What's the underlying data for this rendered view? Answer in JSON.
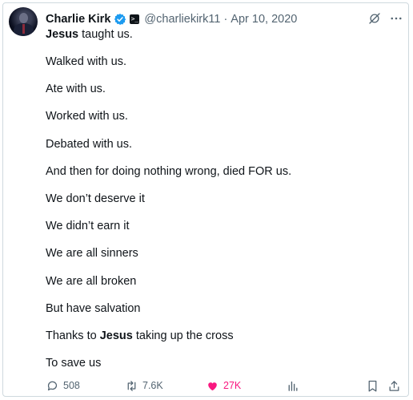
{
  "author": {
    "name": "Charlie Kirk",
    "handle": "@charliekirk11",
    "separator": "·",
    "date": "Apr 10, 2020",
    "affiliate_badge": ">_"
  },
  "tweet": {
    "lines": [
      {
        "bold": "Jesus",
        "text": " taught us."
      },
      {
        "bold": "",
        "text": "Walked with us."
      },
      {
        "bold": "",
        "text": "Ate with us."
      },
      {
        "bold": "",
        "text": "Worked with us."
      },
      {
        "bold": "",
        "text": "Debated with us."
      },
      {
        "bold": "",
        "text": "And then for doing nothing wrong, died FOR us."
      },
      {
        "bold": "",
        "text": "We don’t deserve it"
      },
      {
        "bold": "",
        "text": "We didn’t earn it"
      },
      {
        "bold": "",
        "text": "We are all sinners"
      },
      {
        "bold": "",
        "text": "We are all broken"
      },
      {
        "bold": "",
        "text": "But have salvation"
      },
      {
        "pre": "Thanks to ",
        "bold": "Jesus",
        "text": " taking up the cross"
      },
      {
        "bold": "",
        "text": "To save us"
      }
    ]
  },
  "actions": {
    "replies": "508",
    "retweets": "7.6K",
    "likes": "27K",
    "liked_color": "#f91880"
  },
  "icons": [
    "verified-icon",
    "affiliate-badge-icon",
    "grok-icon",
    "more-icon",
    "reply-icon",
    "retweet-icon",
    "like-icon",
    "views-icon",
    "bookmark-icon",
    "share-icon"
  ],
  "colors": {
    "verified": "#1d9bf0",
    "secondary_text": "#536471",
    "text": "#0f1419"
  }
}
